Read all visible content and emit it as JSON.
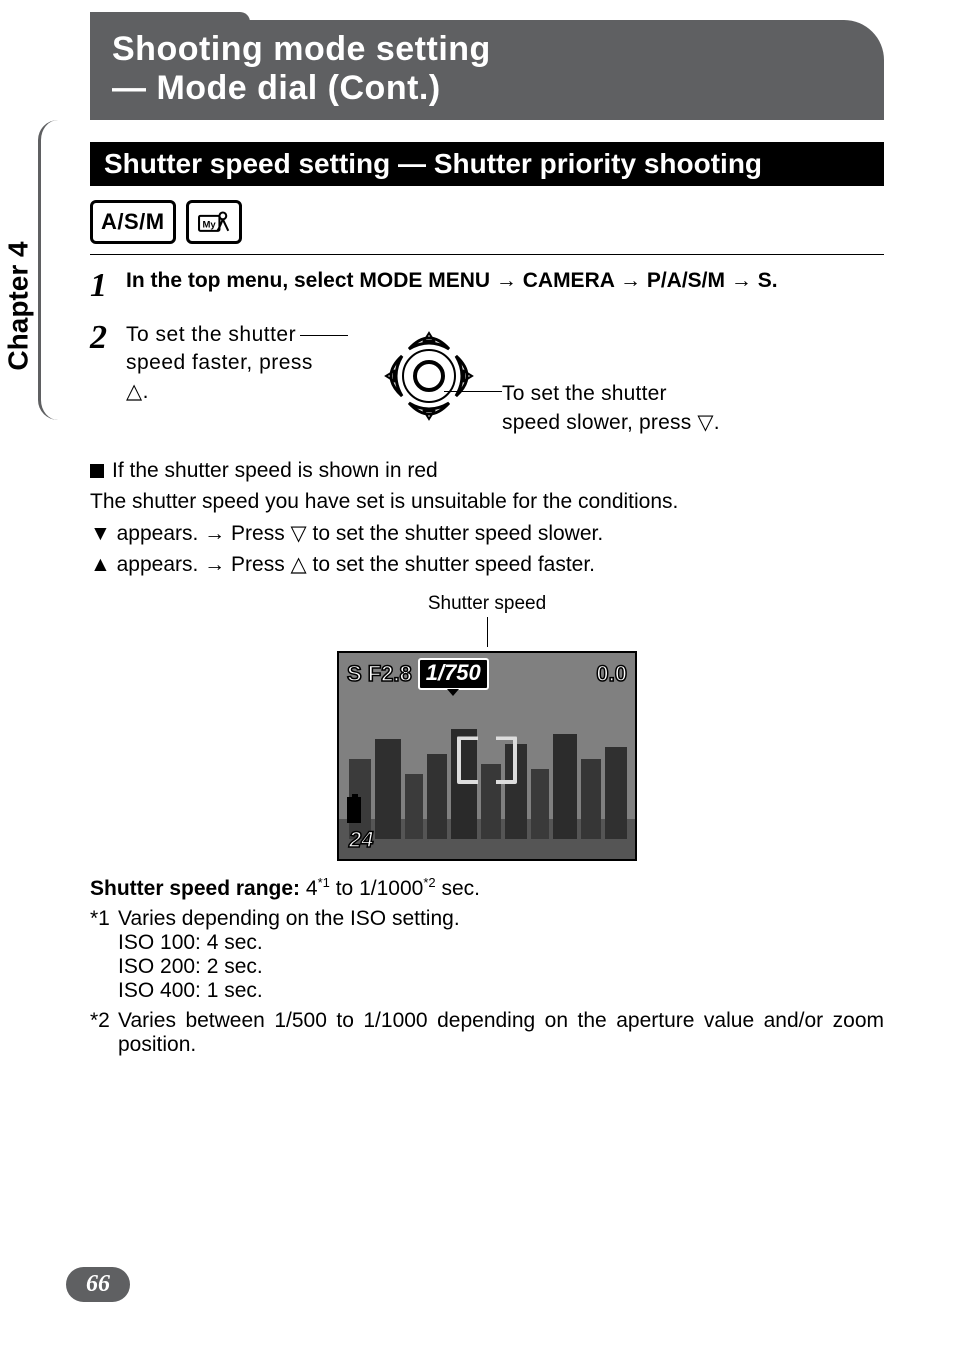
{
  "banner": {
    "line1": "Shooting mode setting",
    "line2": "— Mode dial (Cont.)"
  },
  "chapter": "Chapter 4",
  "section_title": "Shutter speed setting — Shutter priority shooting",
  "modes": {
    "asm": "A/S/M",
    "my": "My"
  },
  "step1": {
    "prefix": "In the top menu, select ",
    "m1": "MODE MENU",
    "m2": "CAMERA",
    "m3": "P/A/S/M",
    "m4": "S."
  },
  "step2": {
    "left_l1": "To set the shutter",
    "left_l2": "speed faster, press",
    "left_l3": "△.",
    "right_l1": "To set the shutter",
    "right_l2": "speed slower, press ▽."
  },
  "red_note": {
    "heading": "If the shutter speed is shown in red",
    "line": "The shutter speed you have set is unsuitable for the conditions.",
    "down": "▼ appears. → Press ▽ to set the shutter speed slower.",
    "up": "▲ appears. → Press △ to set the shutter speed faster."
  },
  "display": {
    "caption": "Shutter speed",
    "mode": "S",
    "fnum": "F2.8",
    "shutter": "1/750",
    "ev": "0.0",
    "shots": "24"
  },
  "range": {
    "label": "Shutter speed range: ",
    "low": "4",
    "low_sup": "*1",
    "to": " to ",
    "high": "1/1000",
    "high_sup": "*2",
    "unit": " sec."
  },
  "footnotes": {
    "f1_head": "*1",
    "f1_line": "Varies depending on the ISO setting.",
    "f1_a": "ISO 100: 4 sec.",
    "f1_b": "ISO 200: 2 sec.",
    "f1_c": "ISO 400: 1 sec.",
    "f2_head": "*2",
    "f2_line": "Varies between 1/500 to 1/1000 depending on the aperture value and/or zoom position."
  },
  "page_number": "66"
}
